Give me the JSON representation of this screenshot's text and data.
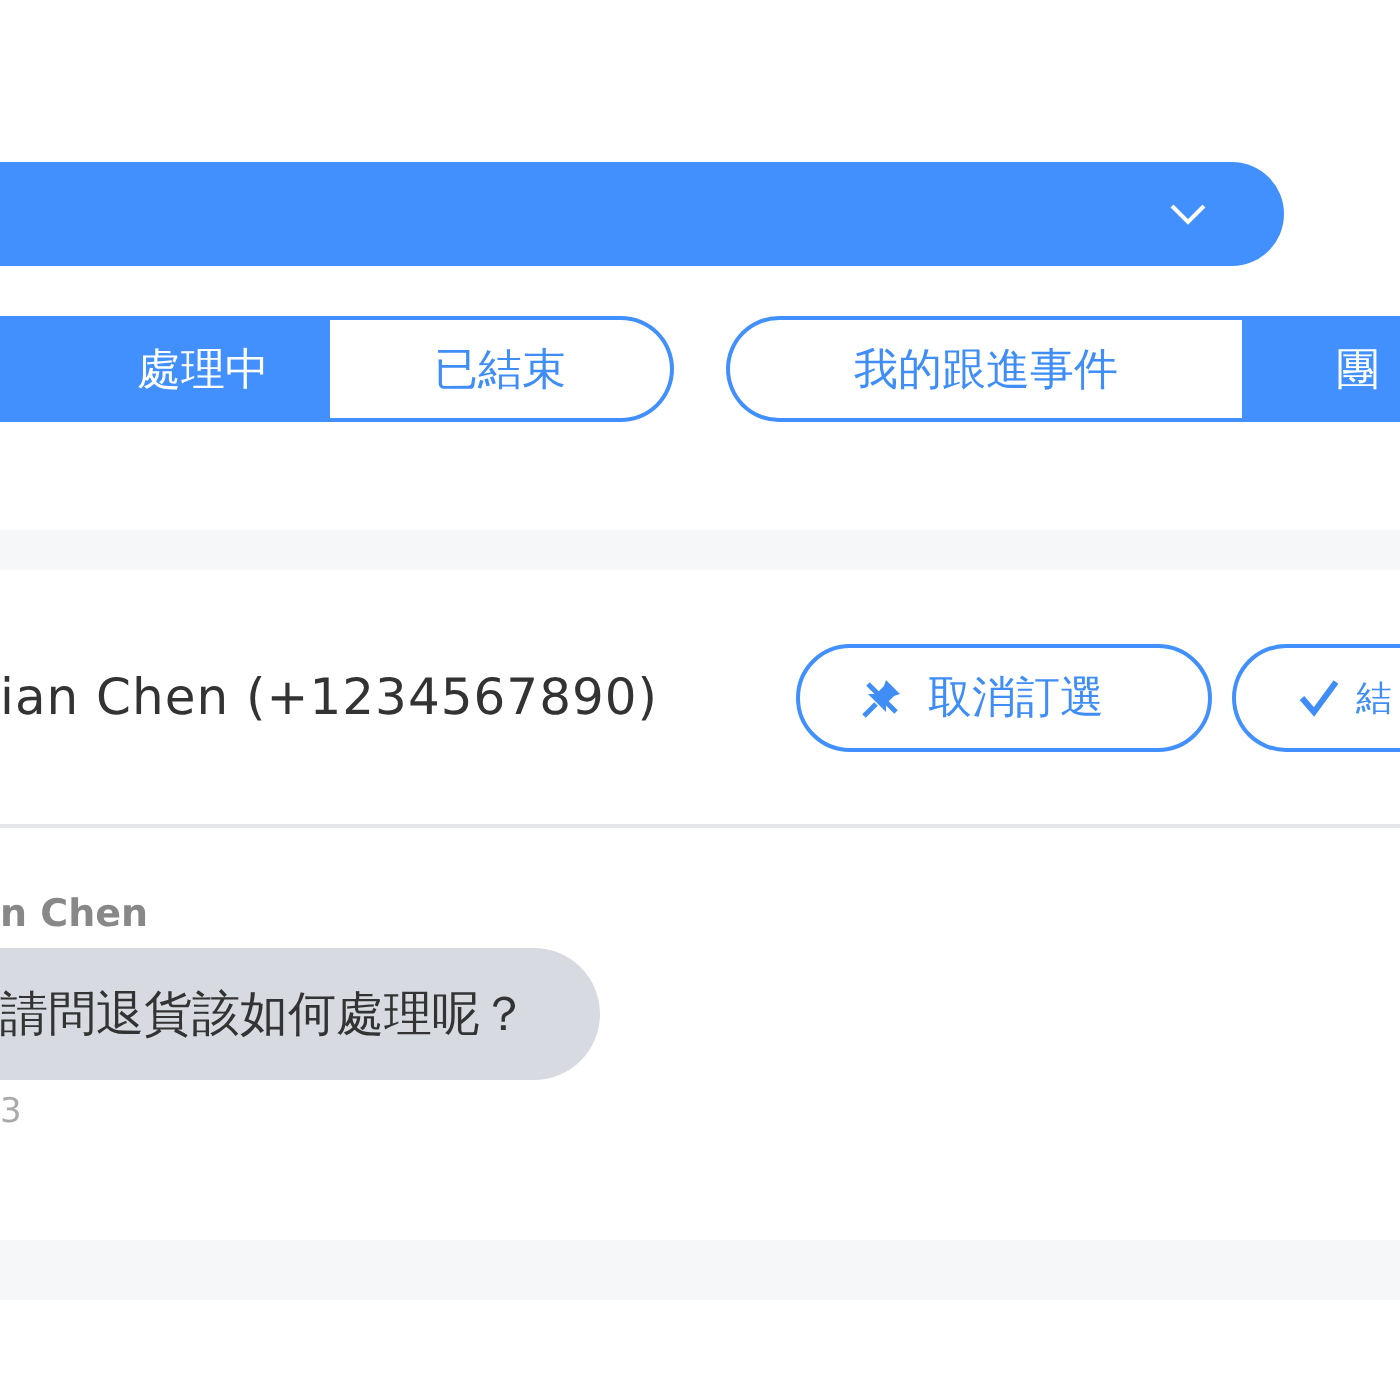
{
  "dropdown": {
    "expanded": false
  },
  "filter_tabs": [
    {
      "label": "處理中",
      "selected": true
    },
    {
      "label": "已結束",
      "selected": false
    }
  ],
  "scope_tabs": [
    {
      "label": "我的跟進事件",
      "selected": false
    },
    {
      "label": "團",
      "selected": true
    }
  ],
  "conversation": {
    "contact": "ian Chen (+1234567890)",
    "actions": [
      {
        "kind": "unpin",
        "label": "取消訂選"
      },
      {
        "kind": "resolve",
        "label": "結"
      }
    ],
    "messages": [
      {
        "sender": "n Chen",
        "text": "請問退貨該如何處理呢？",
        "time": "3"
      }
    ]
  }
}
